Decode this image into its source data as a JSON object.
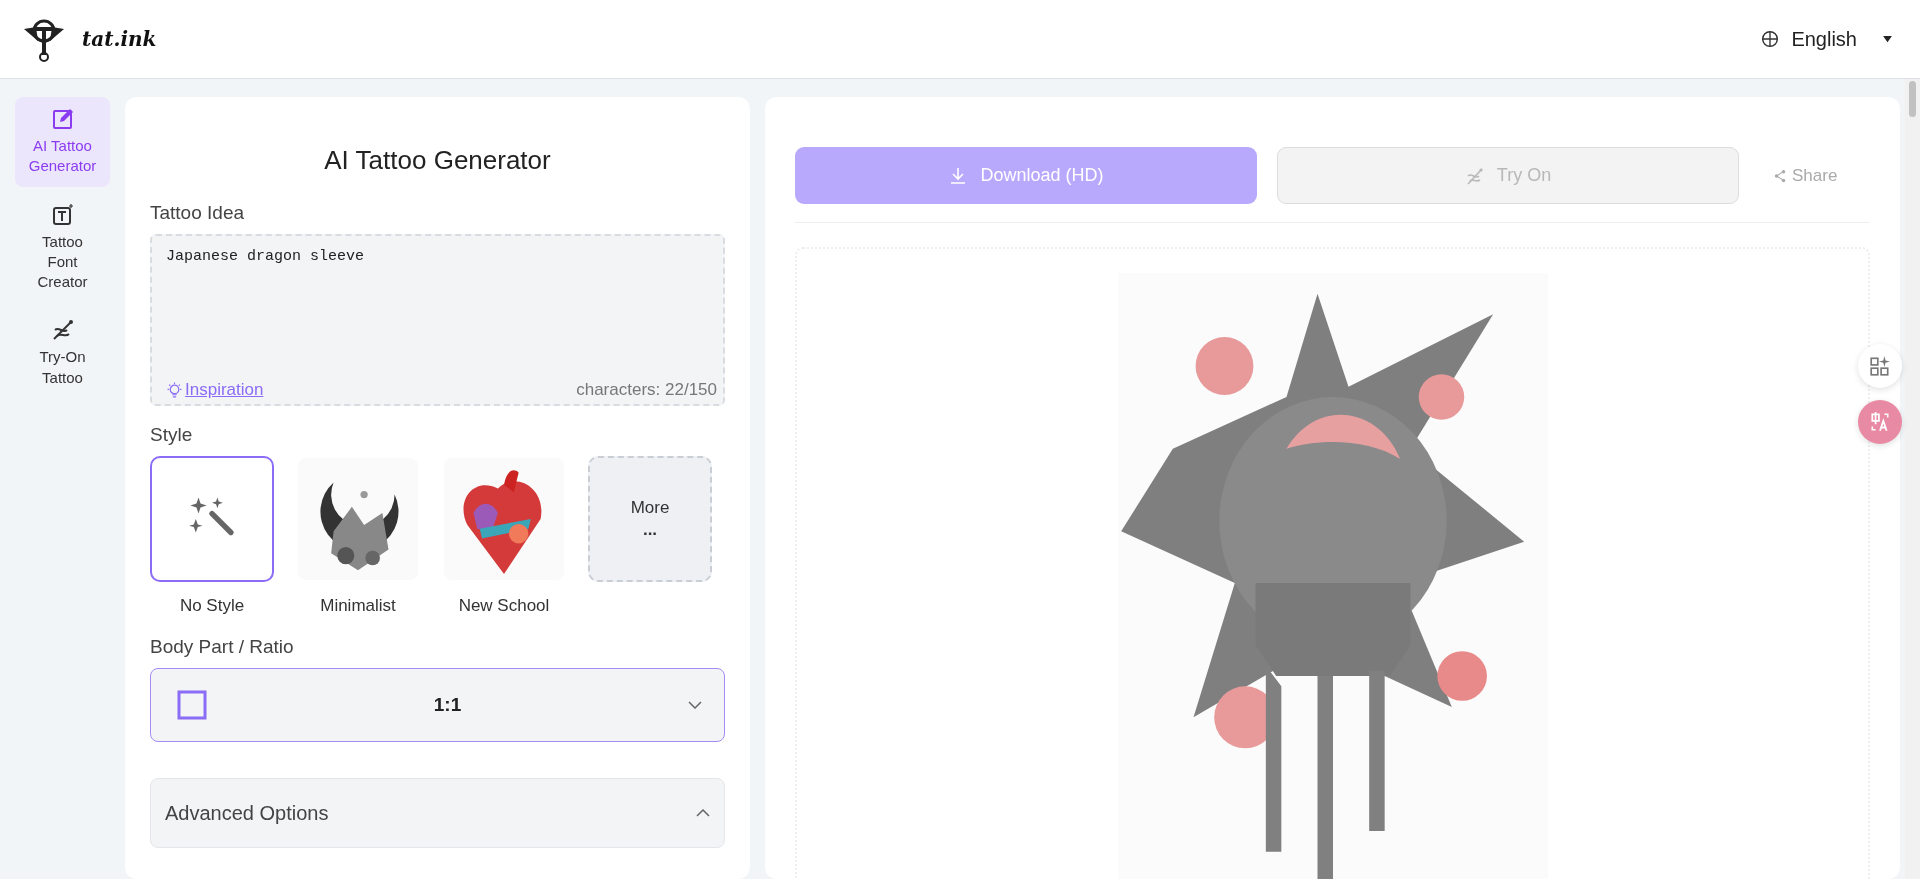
{
  "header": {
    "brand": "tat.ink",
    "language": "English"
  },
  "sidebar": {
    "items": [
      {
        "label": "AI Tattoo Generator",
        "selected": true
      },
      {
        "label": "Tattoo Font Creator",
        "selected": false
      },
      {
        "label": "Try-On Tattoo",
        "selected": false
      }
    ]
  },
  "form": {
    "title": "AI Tattoo Generator",
    "idea_label": "Tattoo Idea",
    "idea_value": "Japanese dragon sleeve",
    "inspiration": "Inspiration",
    "counter": "characters: 22/150",
    "style_label": "Style",
    "styles": [
      {
        "kind": "icon",
        "label": "No Style",
        "selected": true
      },
      {
        "kind": "picture",
        "label": "Minimalist",
        "selected": false
      },
      {
        "kind": "picture",
        "label": "New School",
        "selected": false
      },
      {
        "kind": "more",
        "label": "More",
        "dots": "..."
      }
    ],
    "ratio_label": "Body Part / Ratio",
    "ratio_value": "1:1",
    "advanced": "Advanced Options"
  },
  "result": {
    "buttons": [
      {
        "label": "Download (HD)",
        "disabled": false
      },
      {
        "label": "Try On",
        "disabled": true
      }
    ],
    "share": "Share"
  }
}
